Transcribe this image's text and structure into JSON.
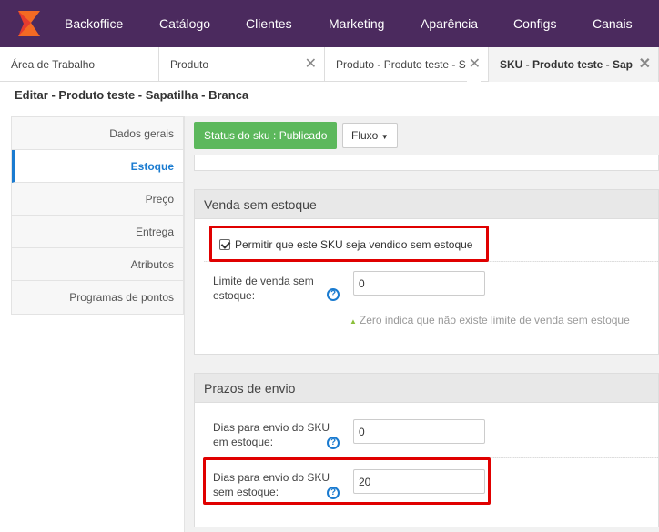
{
  "nav": {
    "items": [
      "Backoffice",
      "Catálogo",
      "Clientes",
      "Marketing",
      "Aparência",
      "Configs",
      "Canais"
    ],
    "bg": "#4b2a5e"
  },
  "tabs": [
    {
      "label": "Área de Trabalho"
    },
    {
      "label": "Produto"
    },
    {
      "label": "Produto - Produto teste - S"
    },
    {
      "label": "SKU - Produto teste - Sap"
    }
  ],
  "page_title": "Editar - Produto teste - Sapatilha - Branca",
  "sidebar": {
    "items": [
      "Dados gerais",
      "Estoque",
      "Preço",
      "Entrega",
      "Atributos",
      "Programas de pontos"
    ],
    "active": "Estoque"
  },
  "actions": {
    "status": "Status do sku : Publicado",
    "fluxo": "Fluxo"
  },
  "venda": {
    "title": "Venda sem estoque",
    "checkbox_label": "Permitir que este SKU seja vendido sem estoque",
    "limit_label_1": "Limite de venda sem",
    "limit_label_2": "estoque:",
    "limit_value": "0",
    "hint": "Zero indica que não existe limite de venda sem estoque"
  },
  "prazos": {
    "title": "Prazos de envio",
    "em_label_1": "Dias para envio do SKU",
    "em_label_2": "em estoque:",
    "em_value": "0",
    "sem_label_1": "Dias para envio do SKU",
    "sem_label_2": "sem estoque:",
    "sem_value": "20"
  },
  "colors": {
    "accent": "#1a7bd0",
    "success": "#5cb85c",
    "highlight": "#e00000"
  }
}
